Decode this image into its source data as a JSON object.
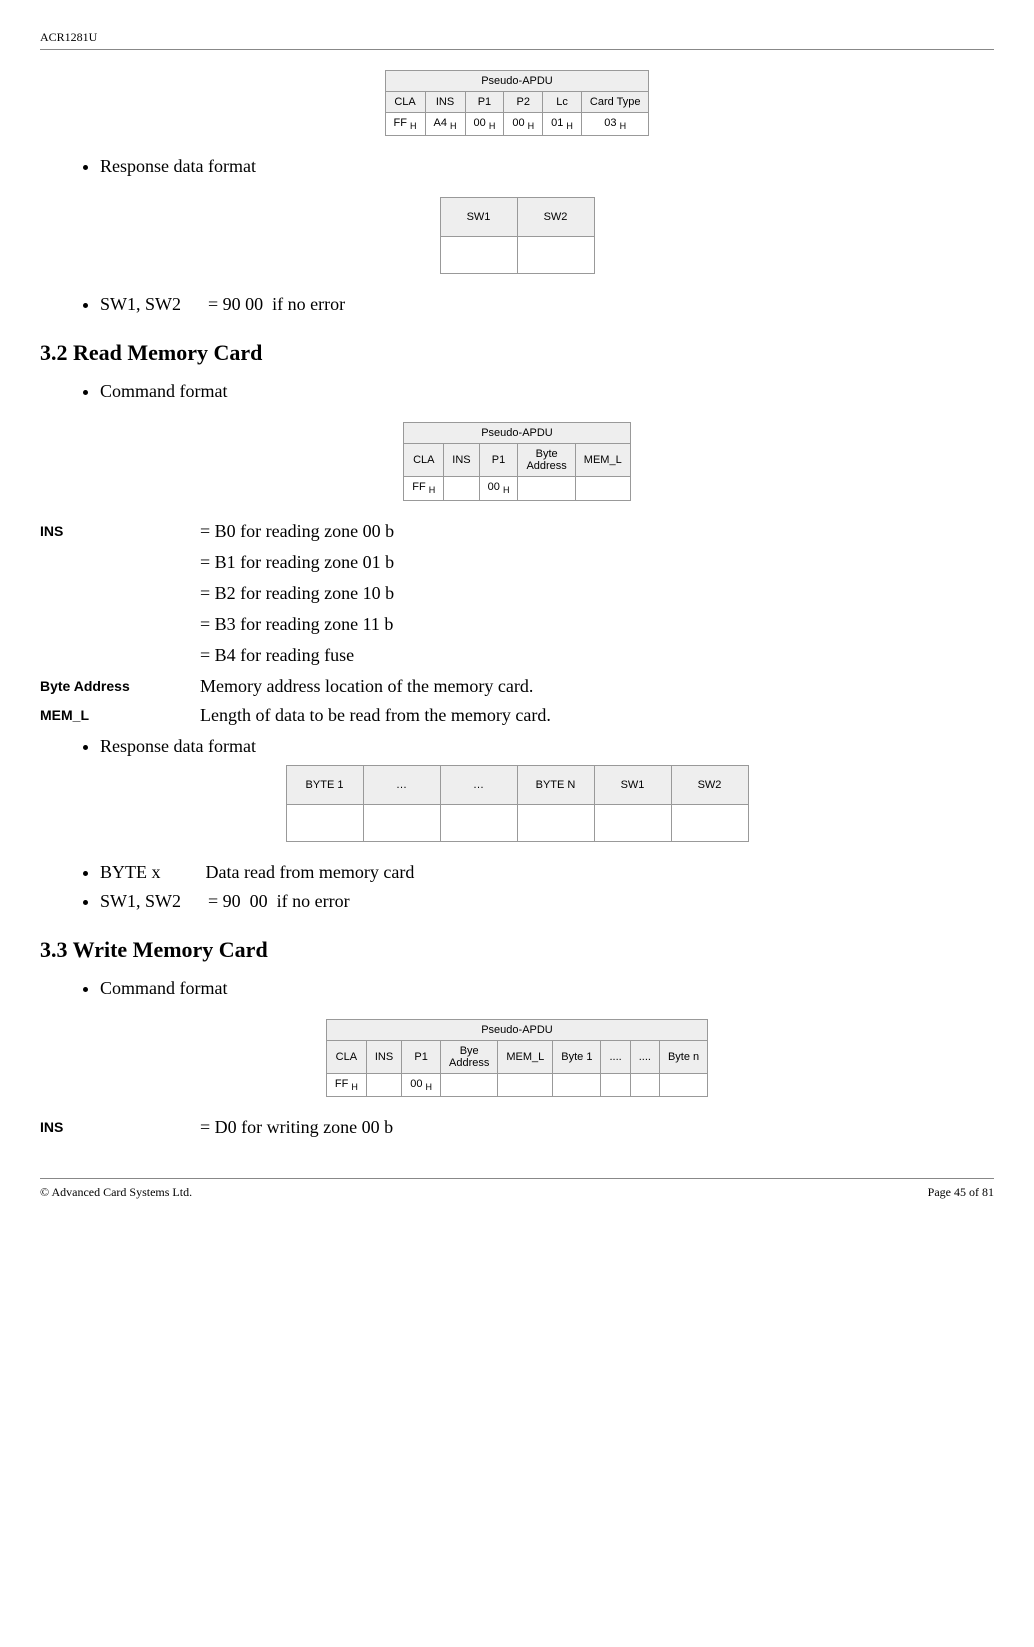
{
  "header": {
    "product": "ACR1281U"
  },
  "table1": {
    "title": "Pseudo-APDU",
    "headers": [
      "CLA",
      "INS",
      "P1",
      "P2",
      "Lc",
      "Card Type"
    ],
    "values": [
      "FF H",
      "A4 H",
      "00 H",
      "00 H",
      "01 H",
      "03 H"
    ]
  },
  "section_response1": "Response data format",
  "tableSW": {
    "headers": [
      "SW1",
      "SW2"
    ]
  },
  "sw_line": "SW1, SW2      = 90 00  if no error",
  "heading32": "3.2 Read Memory Card",
  "cmd_format": "Command format",
  "table2": {
    "title": "Pseudo-APDU",
    "headers": [
      "CLA",
      "INS",
      "P1",
      "Byte Address",
      "MEM_L"
    ],
    "values": [
      "FF H",
      "",
      "00 H",
      "",
      ""
    ]
  },
  "ins_label": "INS",
  "ins_b0": "= B0  for reading zone 00 b",
  "ins_b1": "= B1  for reading zone 01 b",
  "ins_b2": "= B2  for reading zone 10 b",
  "ins_b3": "= B3  for reading zone 11 b",
  "ins_b4": "= B4  for reading fuse",
  "byte_addr_label": "Byte Address",
  "byte_addr_value": "Memory address location of the memory card.",
  "mem_l_label": "MEM_L",
  "mem_l_value": "Length of data to be read from the memory card.",
  "section_response2": "Response data format",
  "table3": {
    "headers": [
      "BYTE 1",
      "…",
      "…",
      "BYTE N",
      "SW1",
      "SW2"
    ]
  },
  "byte_x_line": "BYTE x          Data read from memory card",
  "sw_line2": "SW1, SW2      = 90  00  if no error",
  "heading33": "3.3 Write Memory Card",
  "table4": {
    "title": "Pseudo-APDU",
    "headers": [
      "CLA",
      "INS",
      "P1",
      "Bye Address",
      "MEM_L",
      "Byte 1",
      "....",
      "....",
      "Byte n"
    ],
    "values": [
      "FF H",
      "",
      "00 H",
      "",
      "",
      "",
      "",
      "",
      ""
    ]
  },
  "ins_d0": "= D0  for writing zone 00 b",
  "footer": {
    "left": "© Advanced Card Systems Ltd.",
    "right": "Page 45 of 81"
  }
}
